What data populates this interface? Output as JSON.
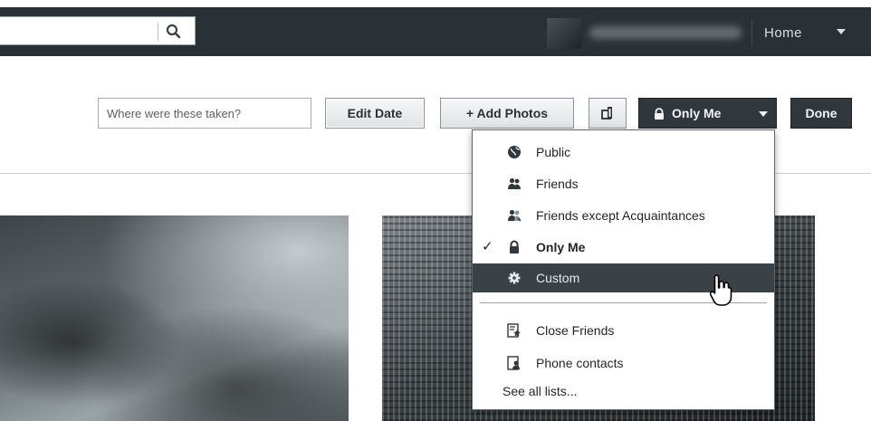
{
  "topbar": {
    "search_placeholder": "",
    "home_label": "Home"
  },
  "toolbar": {
    "location_placeholder": "Where were these taken?",
    "edit_date_label": "Edit Date",
    "add_photos_label": "+ Add Photos",
    "privacy_label": "Only Me",
    "done_label": "Done"
  },
  "privacy_menu": {
    "items": [
      {
        "label": "Public",
        "icon": "globe-icon",
        "selected": false,
        "hovered": false
      },
      {
        "label": "Friends",
        "icon": "friends-icon",
        "selected": false,
        "hovered": false
      },
      {
        "label": "Friends except Acquaintances",
        "icon": "friends-except-icon",
        "selected": false,
        "hovered": false
      },
      {
        "label": "Only Me",
        "icon": "lock-icon",
        "selected": true,
        "hovered": false
      },
      {
        "label": "Custom",
        "icon": "gear-icon",
        "selected": false,
        "hovered": true
      }
    ],
    "check_mark": "✓",
    "lists": [
      {
        "label": "Close Friends",
        "icon": "star-list-icon"
      },
      {
        "label": "Phone contacts",
        "icon": "contacts-list-icon"
      }
    ],
    "see_all_label": "See all lists..."
  },
  "colors": {
    "topbar_bg": "#2a3136",
    "dark_button_bg": "#30383d",
    "menu_hover_bg": "#3a4247"
  }
}
